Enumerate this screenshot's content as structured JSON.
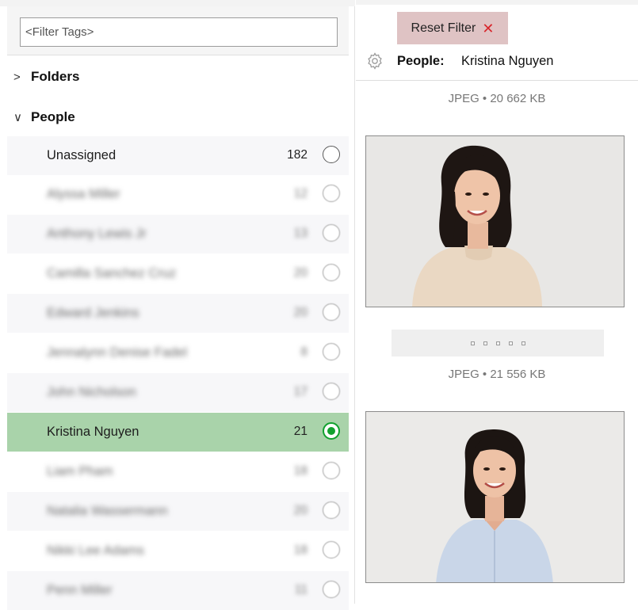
{
  "tags_panel": {
    "filter": {
      "placeholder": "<Filter Tags>",
      "value": ""
    },
    "sections": [
      {
        "label": "Folders",
        "state": "collapsed",
        "icon": "chevron-right-icon"
      },
      {
        "label": "People",
        "state": "expanded",
        "icon": "chevron-down-icon"
      }
    ],
    "people": [
      {
        "name": "Unassigned",
        "count": "182",
        "selected": false,
        "blurred": false
      },
      {
        "name": "Alyssa Miller",
        "count": "12",
        "selected": false,
        "blurred": true
      },
      {
        "name": "Anthony Lewis Jr",
        "count": "13",
        "selected": false,
        "blurred": true
      },
      {
        "name": "Camilla Sanchez Cruz",
        "count": "20",
        "selected": false,
        "blurred": true
      },
      {
        "name": "Edward Jenkins",
        "count": "20",
        "selected": false,
        "blurred": true
      },
      {
        "name": "Jennalynn Denise Fadel",
        "count": "8",
        "selected": false,
        "blurred": true
      },
      {
        "name": "John Nicholson",
        "count": "17",
        "selected": false,
        "blurred": true
      },
      {
        "name": "Kristina Nguyen",
        "count": "21",
        "selected": true,
        "blurred": false
      },
      {
        "name": "Liam Pham",
        "count": "18",
        "selected": false,
        "blurred": true
      },
      {
        "name": "Natalia Wassermann",
        "count": "20",
        "selected": false,
        "blurred": true
      },
      {
        "name": "Nikki Lee Adams",
        "count": "18",
        "selected": false,
        "blurred": true
      },
      {
        "name": "Penn Miller",
        "count": "11",
        "selected": false,
        "blurred": true
      }
    ]
  },
  "viewer": {
    "reset_filter_label": "Reset Filter",
    "reset_icon": "close-x-icon",
    "filter_icon": "gear-icon",
    "filter_label": "People:",
    "filter_value": "Kristina Nguyen",
    "items": [
      {
        "meta": "JPEG • 20 662 KB",
        "thumbnail": "woman-beige-sweater-photo"
      },
      {
        "meta": "JPEG • 21 556 KB",
        "thumbnail": "woman-blue-shirt-photo",
        "rating": {
          "value": 0,
          "max": 5
        }
      }
    ]
  },
  "colors": {
    "selected_row": "#a9d3aa",
    "radio_selected": "#11a12e",
    "reset_button_bg": "#dfc3c4",
    "reset_x": "#d8262b"
  }
}
